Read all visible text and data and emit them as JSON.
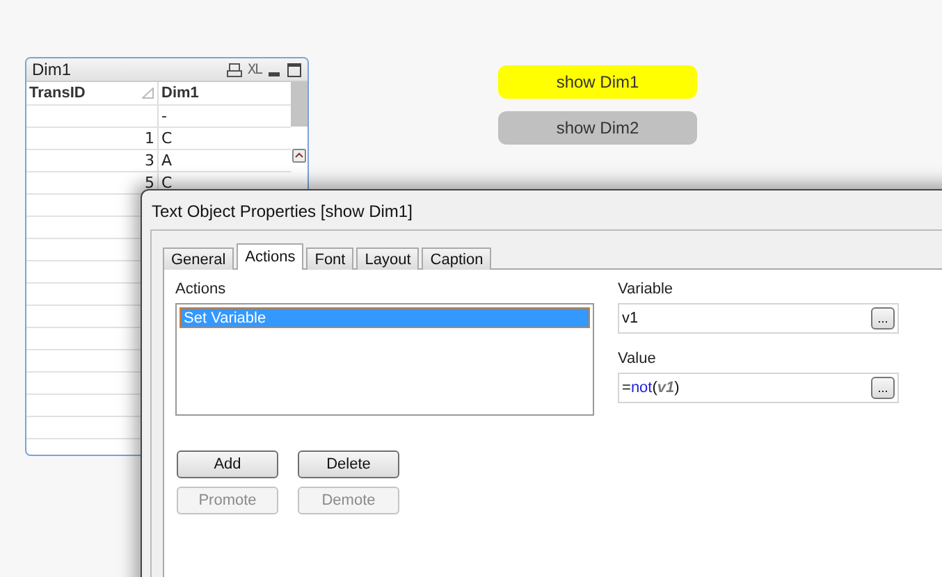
{
  "table_box": {
    "title": "Dim1",
    "xl_label": "XL",
    "columns": [
      {
        "label": "TransID",
        "sorted": true
      },
      {
        "label": "Dim1",
        "sorted": false
      }
    ],
    "rows": [
      {
        "transid": "",
        "dim1": "-"
      },
      {
        "transid": "1",
        "dim1": "C"
      },
      {
        "transid": "3",
        "dim1": "A"
      },
      {
        "transid": "5",
        "dim1": "C"
      }
    ]
  },
  "buttons": [
    {
      "label": "show Dim1",
      "color": "#ffff00"
    },
    {
      "label": "show Dim2",
      "color": "#c0c0c0"
    }
  ],
  "dialog": {
    "title": "Text Object Properties [show Dim1]",
    "tabs": [
      {
        "label": "General",
        "selected": false
      },
      {
        "label": "Actions",
        "selected": true
      },
      {
        "label": "Font",
        "selected": false
      },
      {
        "label": "Layout",
        "selected": false
      },
      {
        "label": "Caption",
        "selected": false
      }
    ],
    "actions_label": "Actions",
    "actions": [
      {
        "label": "Set Variable",
        "selected": true
      }
    ],
    "variable_label": "Variable",
    "variable_value": "v1",
    "value_label": "Value",
    "value_tokens": [
      {
        "text": "=",
        "kind": "operator"
      },
      {
        "text": "not",
        "kind": "function"
      },
      {
        "text": "(",
        "kind": "operator"
      },
      {
        "text": "v1",
        "kind": "variable"
      },
      {
        "text": ")",
        "kind": "operator"
      }
    ],
    "browse_label": "...",
    "action_buttons": [
      {
        "label": "Add",
        "disabled": false
      },
      {
        "label": "Delete",
        "disabled": false
      },
      {
        "label": "Promote",
        "disabled": true
      },
      {
        "label": "Demote",
        "disabled": true
      }
    ]
  }
}
